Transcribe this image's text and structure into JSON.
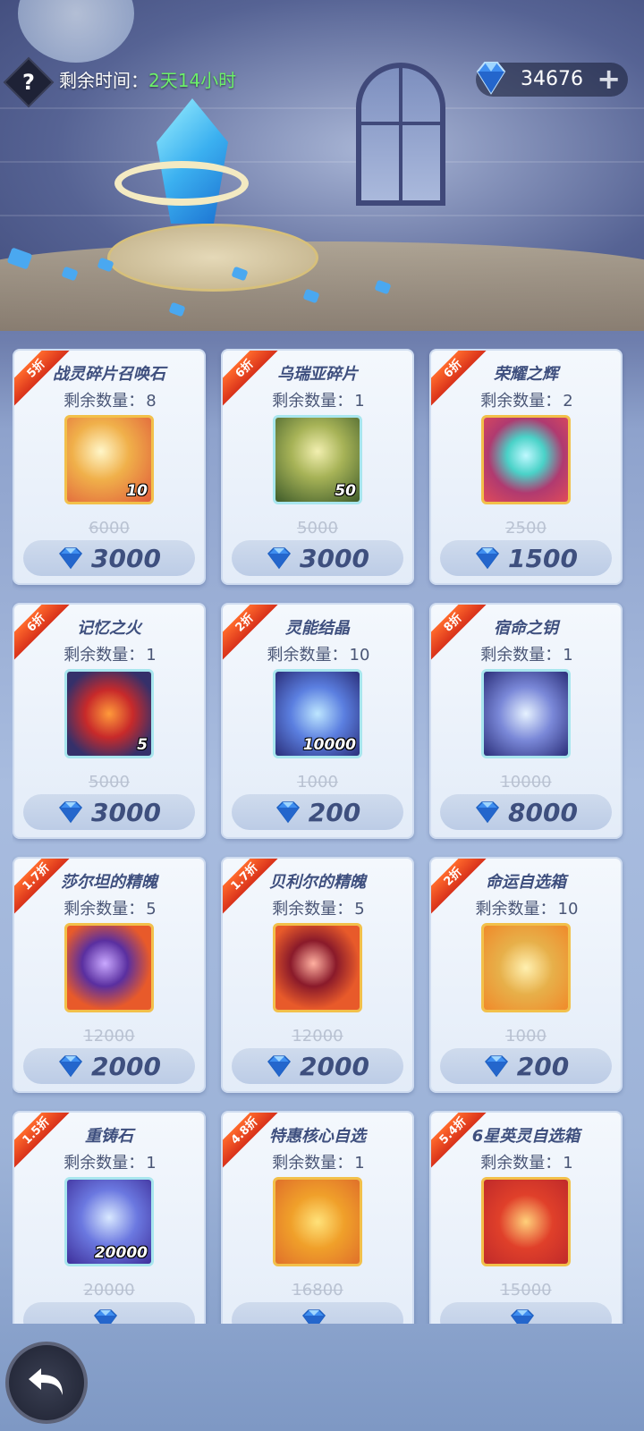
{
  "header": {
    "help_glyph": "?",
    "timer_label": "剩余时间：",
    "timer_value": "2天14小时",
    "currency_amount": "34676",
    "currency_icon": "diamond-icon",
    "add_glyph": "+"
  },
  "items": [
    {
      "discount": "5折",
      "name": "战灵碎片召唤石",
      "qty_label": "剩余数量：",
      "qty": "8",
      "count": "10",
      "orig": "6000",
      "price": "3000",
      "art": "summon-stone"
    },
    {
      "discount": "6折",
      "name": "乌瑞亚碎片",
      "qty_label": "剩余数量：",
      "qty": "1",
      "count": "50",
      "orig": "5000",
      "price": "3000",
      "art": "hero-shard"
    },
    {
      "discount": "6折",
      "name": "荣耀之辉",
      "qty_label": "剩余数量：",
      "qty": "2",
      "count": "",
      "orig": "2500",
      "price": "1500",
      "art": "glory-orb"
    },
    {
      "discount": "6折",
      "name": "记忆之火",
      "qty_label": "剩余数量：",
      "qty": "1",
      "count": "5",
      "orig": "5000",
      "price": "3000",
      "art": "memory-fire"
    },
    {
      "discount": "2折",
      "name": "灵能结晶",
      "qty_label": "剩余数量：",
      "qty": "10",
      "count": "10000",
      "orig": "1000",
      "price": "200",
      "art": "psi-crystal"
    },
    {
      "discount": "8折",
      "name": "宿命之钥",
      "qty_label": "剩余数量：",
      "qty": "1",
      "count": "",
      "orig": "10000",
      "price": "8000",
      "art": "fate-key"
    },
    {
      "discount": "1.7折",
      "name": "莎尔坦的精魄",
      "qty_label": "剩余数量：",
      "qty": "5",
      "count": "",
      "orig": "12000",
      "price": "2000",
      "art": "soul-orb-purple"
    },
    {
      "discount": "1.7折",
      "name": "贝利尔的精魄",
      "qty_label": "剩余数量：",
      "qty": "5",
      "count": "",
      "orig": "12000",
      "price": "2000",
      "art": "soul-orb-red"
    },
    {
      "discount": "2折",
      "name": "命运自选箱",
      "qty_label": "剩余数量：",
      "qty": "10",
      "count": "",
      "orig": "1000",
      "price": "200",
      "art": "fate-chest"
    },
    {
      "discount": "1.5折",
      "name": "重铸石",
      "qty_label": "剩余数量：",
      "qty": "1",
      "count": "20000",
      "orig": "20000",
      "price": "",
      "art": "reforge-stone"
    },
    {
      "discount": "4.8折",
      "name": "特惠核心自选",
      "qty_label": "剩余数量：",
      "qty": "1",
      "count": "",
      "orig": "16800",
      "price": "",
      "art": "core-card"
    },
    {
      "discount": "5.4折",
      "name": "6星英灵自选箱",
      "qty_label": "剩余数量：",
      "qty": "1",
      "count": "",
      "orig": "15000",
      "price": "",
      "art": "hero-helmet"
    }
  ],
  "colors": {
    "accent_text": "#3e4f7e",
    "discount_ribbon": "#e8431f",
    "timer_green": "#6cf06a"
  },
  "footer": {
    "back_icon": "back-arrow-icon"
  }
}
